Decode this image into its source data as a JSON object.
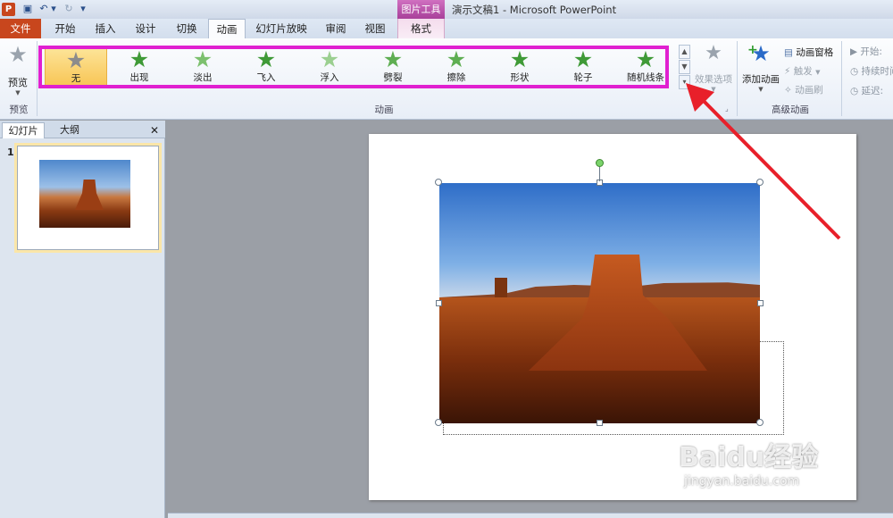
{
  "titlebar": {
    "app_icon": "P",
    "context_tab_title": "图片工具",
    "window_title": "演示文稿1 - Microsoft PowerPoint",
    "quick_access_icons": [
      "save-icon",
      "undo-icon",
      "undo-dropdown-icon",
      "redo-icon",
      "customize-dropdown-icon"
    ]
  },
  "tabs": {
    "file": "文件",
    "home": "开始",
    "insert": "插入",
    "design": "设计",
    "transitions": "切换",
    "animations": "动画",
    "slideshow": "幻灯片放映",
    "review": "审阅",
    "view": "视图",
    "format": "格式"
  },
  "ribbon": {
    "preview_label": "预览",
    "preview_group": "预览",
    "animation_group": "动画",
    "effect_options": "效果选项",
    "add_animation": "添加动画",
    "animation_pane": "动画窗格",
    "trigger": "触发",
    "animation_painter": "动画刷",
    "advanced_group": "高级动画",
    "start_label": "开始:",
    "duration_label": "持续时间",
    "delay_label": "延迟:"
  },
  "gallery": [
    {
      "label": "无",
      "color": "#8c8c8c"
    },
    {
      "label": "出现",
      "color": "#3f9a37"
    },
    {
      "label": "淡出",
      "color": "#7cc06e"
    },
    {
      "label": "飞入",
      "color": "#3f9a37"
    },
    {
      "label": "浮入",
      "color": "#9bcf90"
    },
    {
      "label": "劈裂",
      "color": "#5eae52"
    },
    {
      "label": "擦除",
      "color": "#5eae52"
    },
    {
      "label": "形状",
      "color": "#3f9a37"
    },
    {
      "label": "轮子",
      "color": "#3f9a37"
    },
    {
      "label": "随机线条",
      "color": "#3f9a37"
    }
  ],
  "panel": {
    "tab_slides": "幻灯片",
    "tab_outline": "大纲",
    "close": "✕",
    "slide_number": "1"
  },
  "watermark": {
    "brand": "Baidu经验",
    "url": "jingyan.baidu.com"
  },
  "colors": {
    "file_tab": "#c8461d",
    "highlight_box": "#e020d0",
    "arrow": "#e8202a",
    "context_tab": "#b84aa8"
  }
}
